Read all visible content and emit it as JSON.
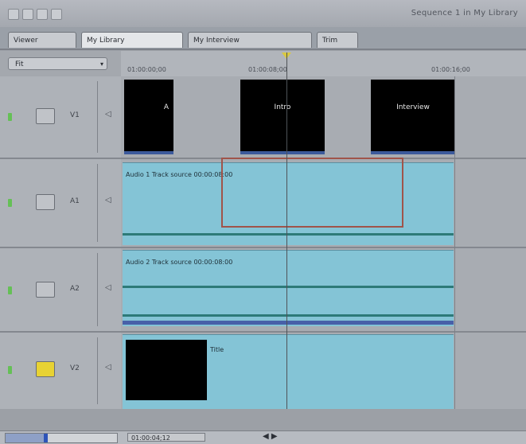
{
  "window": {
    "title": "Sequence 1 in My Library"
  },
  "tabs": [
    {
      "label": "Viewer"
    },
    {
      "label": "My Library"
    },
    {
      "label": "My Interview"
    },
    {
      "label": "Trim"
    }
  ],
  "zoom_select": {
    "value": "Fit",
    "arrow": "▾"
  },
  "ruler": {
    "timecodes": [
      "01:00:00;00",
      "01:00:08;00",
      "01:00:16;00"
    ],
    "playhead_color": "#d9c940"
  },
  "tracks": [
    {
      "label": "V1",
      "speaker_icon": "◁"
    },
    {
      "label": "A1",
      "speaker_icon": "◁"
    },
    {
      "label": "A2",
      "speaker_icon": "◁"
    },
    {
      "label": "V2",
      "speaker_icon": "◁"
    }
  ],
  "clips": {
    "v1": [
      {
        "name": "A"
      },
      {
        "name": "Intro"
      },
      {
        "name": "Interview"
      }
    ],
    "a1": {
      "name": "Audio 1 Track source 00:00:08:00"
    },
    "a2": {
      "name": "Audio 2 Track source 00:00:08:00"
    },
    "v2": {
      "name": "Title"
    }
  },
  "bottom": {
    "timecode": "01:00:04;12",
    "nav_icon": "◀ ▶",
    "zoom_fraction": 0.35
  },
  "colors": {
    "audio_clip": "#84c4d6",
    "video_clip": "#000000",
    "selection": "#a0544a",
    "enabled_track": "#e8d233"
  }
}
